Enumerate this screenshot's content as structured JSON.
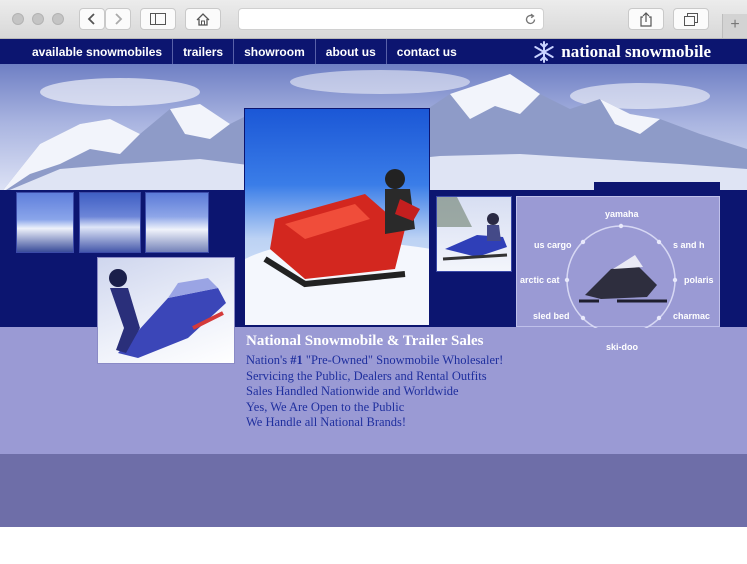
{
  "nav": {
    "items": [
      {
        "label": "available snowmobiles"
      },
      {
        "label": "trailers"
      },
      {
        "label": "showroom"
      },
      {
        "label": "about us"
      },
      {
        "label": "contact us"
      }
    ],
    "brand": "national snowmobile"
  },
  "brands": {
    "labels": [
      "yamaha",
      "s and h",
      "polaris",
      "charmac",
      "ski-doo",
      "sled bed",
      "arctic cat",
      "us cargo"
    ]
  },
  "main": {
    "headline": "National Snowmobile & Trailer Sales",
    "line1_pre": "Nation's ",
    "line1_bold": "#1",
    "line1_post": " \"Pre-Owned\" Snowmobile Wholesaler!",
    "line2": "Servicing the Public, Dealers and Rental Outfits",
    "line3": "Sales Handled Nationwide and Worldwide",
    "line4": "Yes, We Are Open to the Public",
    "line5": "We Handle all National Brands!"
  },
  "colors": {
    "nav_bg": "#0c1570",
    "lavender": "#9a9ad4",
    "text_blue": "#1f2f9e"
  }
}
